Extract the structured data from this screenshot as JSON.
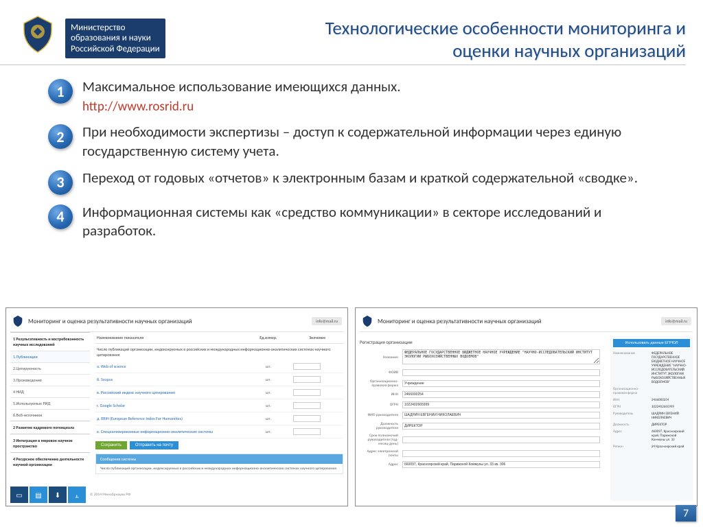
{
  "header": {
    "ministry_line1": "Министерство",
    "ministry_line2": "образования и науки",
    "ministry_line3": "Российской Федерации",
    "title_line1": "Технологические особенности мониторинга и",
    "title_line2": "оценки научных организаций"
  },
  "items": [
    {
      "n": "1",
      "text": "Максимальное использование имеющихся данных.",
      "url": "http://www.rosrid.ru"
    },
    {
      "n": "2",
      "text": "При необходимости экспертизы – доступ к содержательной информации через единую государственную систему учета."
    },
    {
      "n": "3",
      "text": "Переход от годовых «отчетов» к электронным базам и краткой содержательной «сводке»."
    },
    {
      "n": "4",
      "text": "Информационная системы как «средство коммуникации» в секторе исследований и разработок."
    }
  ],
  "shot1": {
    "title": "Мониторинг и оценка результативности научных организаций",
    "login": "info@mail.ru",
    "side_head1": "1 Результативность и востребованность научных исследований",
    "side_items": [
      "1.Публикации",
      "2.Цитируемость",
      "3.Произведения",
      "4 НИД",
      "5.Используемые РИД",
      "6.Веб-источники"
    ],
    "side_head2": "2 Развитие кадрового потенциала",
    "side_head3": "3 Интеграция в мировое научное пространство",
    "side_head4": "4 Ресурсное обеспечение деятельности научной организации",
    "cols": {
      "name": "Наименование показателя",
      "unit": "Ед.измер.",
      "val": "Значение"
    },
    "section": "Число публикаций организации, индексируемых в российских и международных информационно-аналитических системах научного цитирования",
    "rows": [
      {
        "name": "a. Web of science",
        "unit": "шт."
      },
      {
        "name": "б. Scopus",
        "unit": "шт."
      },
      {
        "name": "в. Российский индекс научного цитирования",
        "unit": "шт."
      },
      {
        "name": "г. Google Scholar",
        "unit": "шт."
      },
      {
        "name": "д. ERIH (European Reference Index For Humanities)",
        "unit": "шт."
      },
      {
        "name": "е. Специализированные информационно-аналитические системы",
        "unit": "шт."
      }
    ],
    "btn_save": "Сохранить",
    "btn_send": "Отправить на почту",
    "sysmsg_head": "Сообщения системы",
    "sysmsg_body": "Число публикаций организации, индексируемых в российских и международных информационно-аналитических системах научного цитирования",
    "copy": "© 2014 Минобрнауки РФ"
  },
  "shot2": {
    "title": "Мониторинг и оценка результативности научных организаций",
    "login": "info@mail.ru",
    "section": "Регистрация организации",
    "fields": {
      "name_lbl": "Название",
      "name_val": "ФЕДЕРАЛЬНОЕ ГОСУДАРСТВЕННОЕ БЮДЖЕТНОЕ НАУЧНОЕ УЧРЕЖДЕНИЕ \"НАУЧНО-ИССЛЕДОВАТЕЛЬСКИЙ ИНСТИТУТ ЭКОЛОГИИ РЫБОХОЗЯЙСТВЕННЫХ ВОДОЕМОВ\"",
      "foiv_lbl": "ФОИВ",
      "opf_lbl": "Организационно-правовая форма",
      "opf_val": "Учреждение",
      "inn_lbl": "ИНН",
      "inn_val": "2466000254",
      "ogrn_lbl": "ОГРН",
      "ogrn_val": "1022402665999",
      "fio_lbl": "ФИО руководителя",
      "fio_val": "ШАДРИН ЕВГЕНИЙ НИКОЛАЕВИЧ",
      "pos_lbl": "Должность руководителя",
      "pos_val": "ДИРЕКТОР",
      "term_lbl": "Срок полномочий руководителя (год-месяц-день)",
      "email_lbl": "Адрес электронной почты",
      "addr_lbl": "Адрес",
      "addr_val": "660097, Красноярский край, Парижской Коммуны ул. 33 кв. 306"
    },
    "right": {
      "btn": "Использовать данные ЕГРЮЛ",
      "name_lbl": "Наименование",
      "name_val": "ФЕДЕРАЛЬНОЕ ГОСУДАРСТВЕННОЕ БЮДЖЕТНОЕ НАУЧНОЕ УЧРЕЖДЕНИЕ \"НАУЧНО-ИССЛЕДОВАТЕЛЬСКИЙ ИНСТИТУТ ЭКОЛОГИИ РЫБОХОЗЯЙСТВЕННЫХ ВОДОЕМОВ\"",
      "opf_lbl": "Организационно-правовая форма",
      "inn_lbl": "ИНН",
      "inn_val": "2466000254",
      "ogrn_lbl": "ОГРН",
      "ogrn_val": "1022402665999",
      "ruk_lbl": "Руководитель",
      "ruk_val": "ШАДРИН ЕВГЕНИЙ НИКОЛАЕВИЧ",
      "pos_lbl": "Должность",
      "pos_val": "ДИРЕКТОР",
      "addr_lbl": "Адрес",
      "addr_val": "660097, Красноярский край, Парижской Коммуны ул. 33",
      "reg_lbl": "Регион",
      "reg_val": "24 Красноярский край"
    }
  },
  "page": "7"
}
